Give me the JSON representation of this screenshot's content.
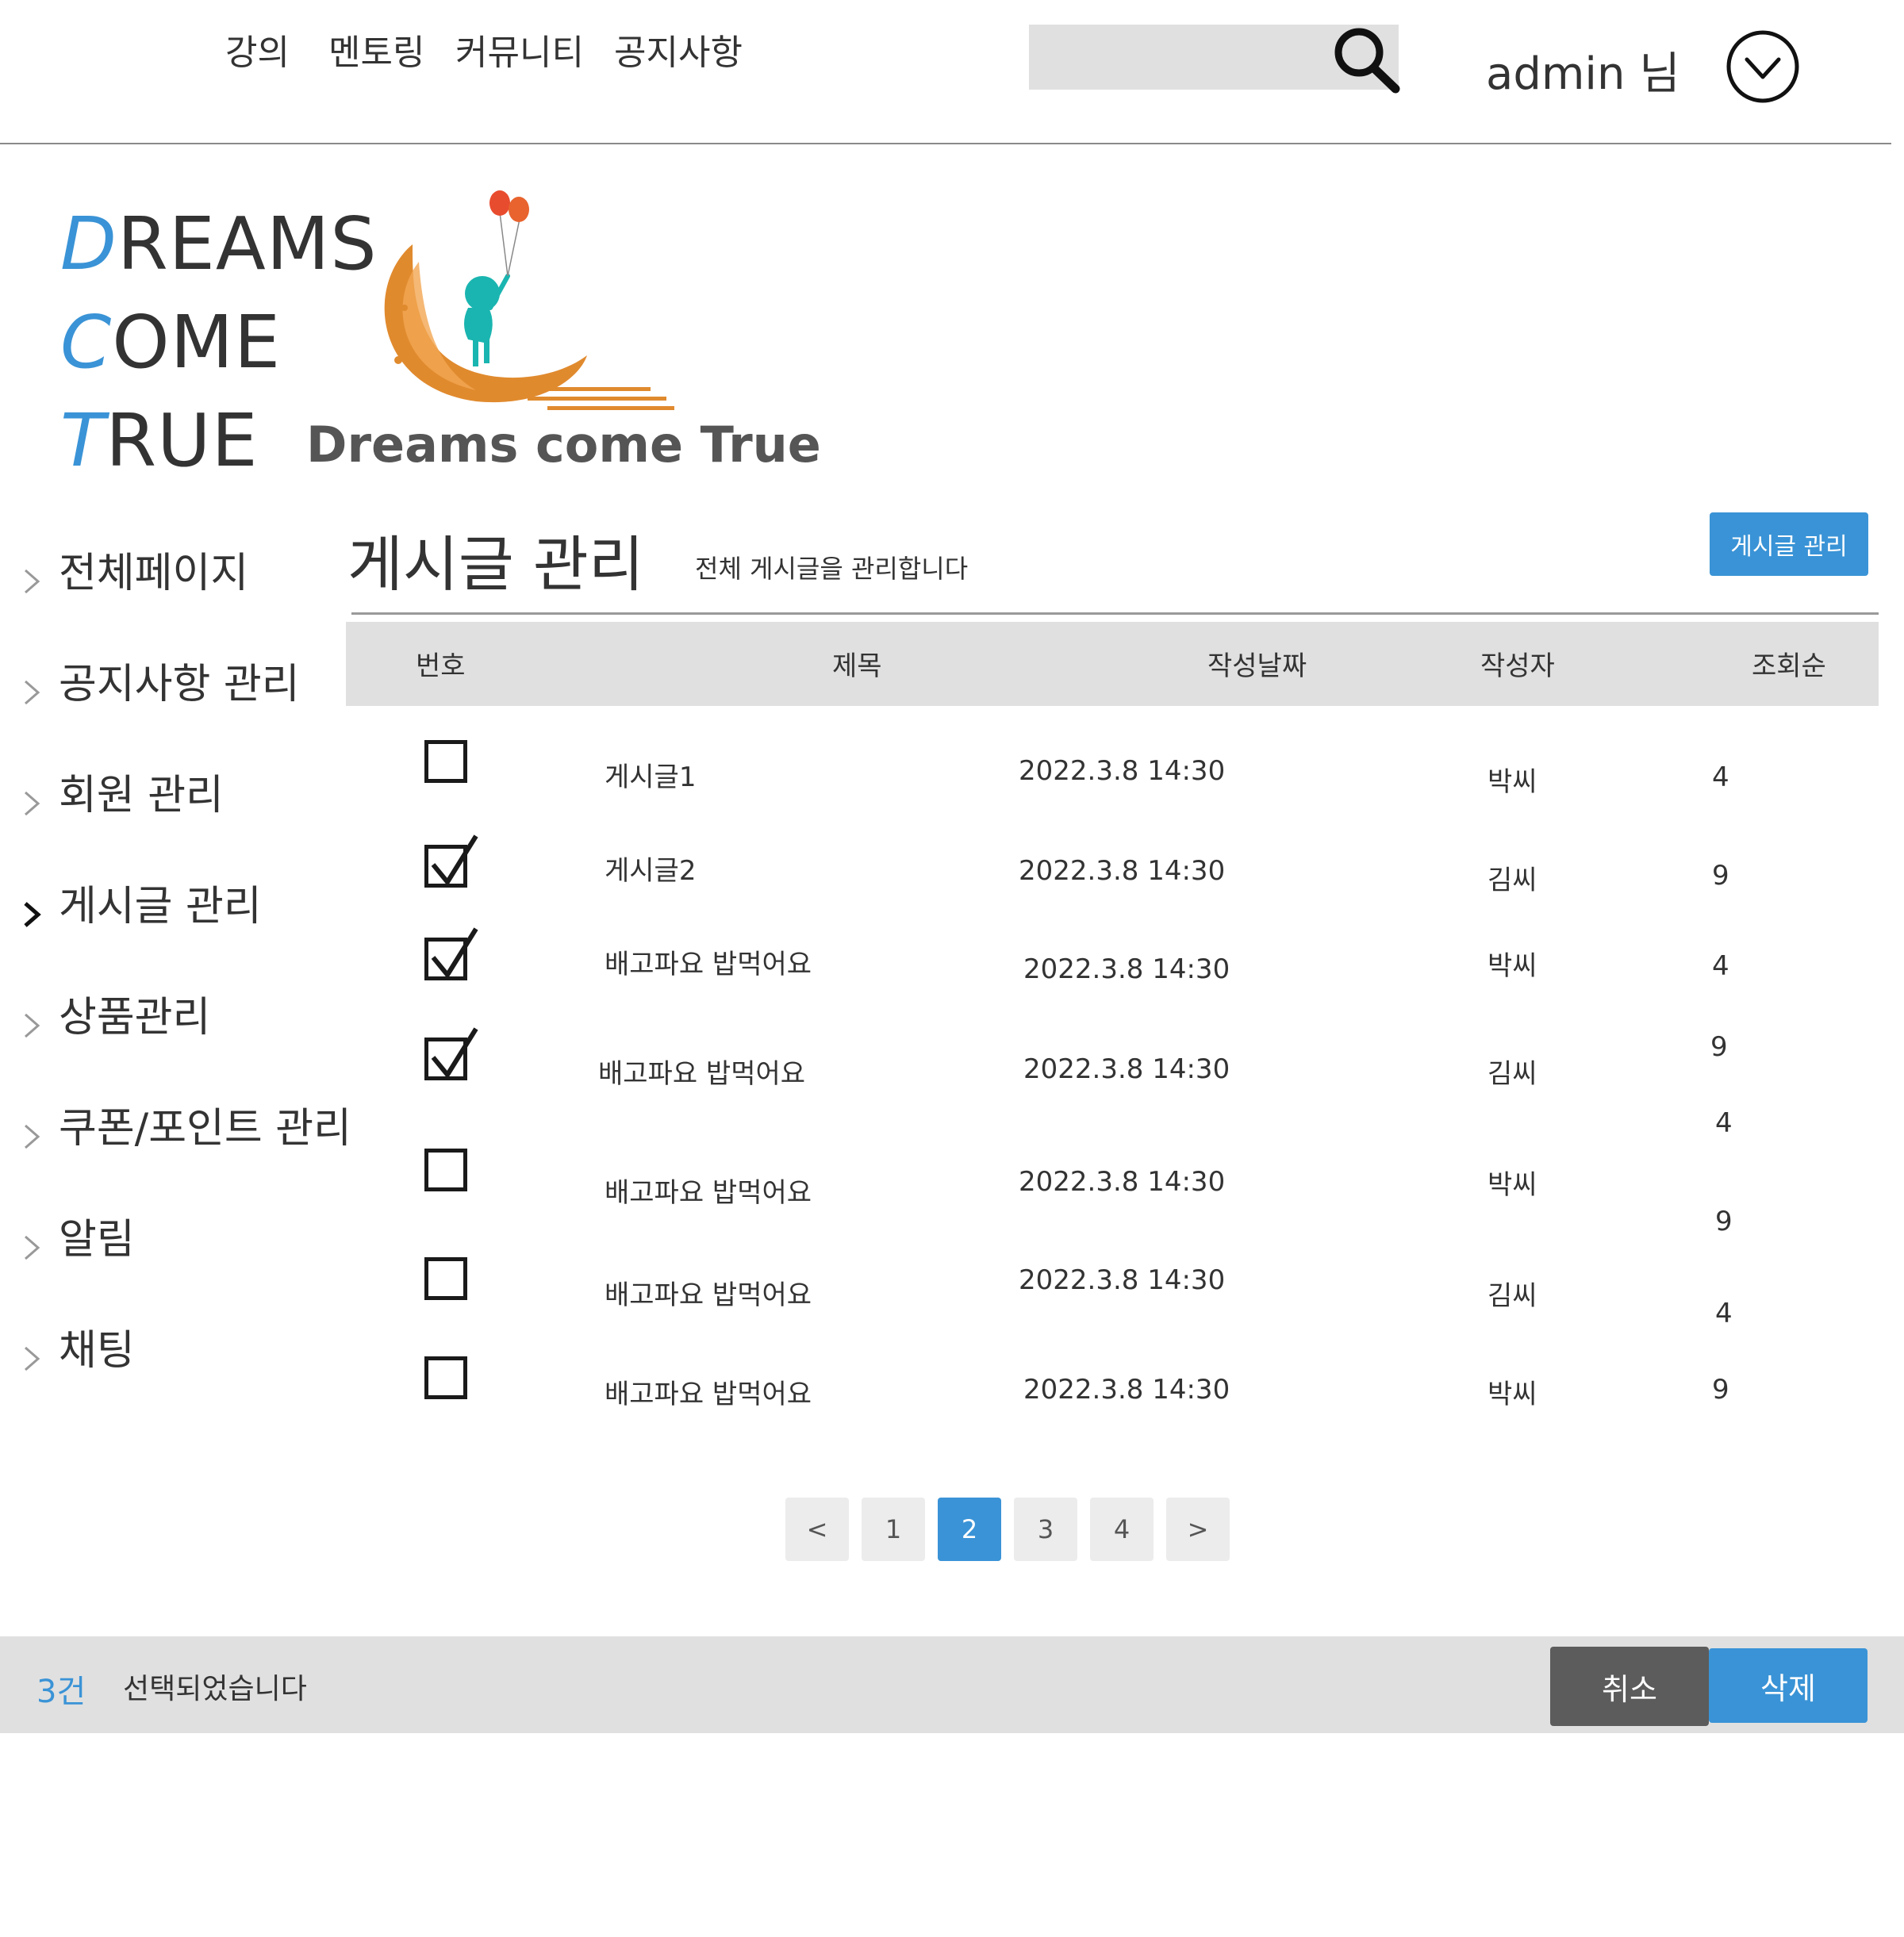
{
  "nav": {
    "items": [
      "강의",
      "멘토링",
      "커뮤니티",
      "공지사항"
    ]
  },
  "search": {
    "placeholder": ""
  },
  "user": {
    "name": "admin 님"
  },
  "logo": {
    "lines": [
      {
        "cap": "D",
        "rest": "REAMS"
      },
      {
        "cap": "C",
        "rest": "OME"
      },
      {
        "cap": "T",
        "rest": "RUE"
      }
    ],
    "tagline": "Dreams come True"
  },
  "sidebar": {
    "items": [
      {
        "label": "전체페이지",
        "active": false
      },
      {
        "label": "공지사항 관리",
        "active": false
      },
      {
        "label": "회원 관리",
        "active": false
      },
      {
        "label": "게시글 관리",
        "active": true
      },
      {
        "label": "상품관리",
        "active": false
      },
      {
        "label": "쿠폰/포인트 관리",
        "active": false
      },
      {
        "label": "알림",
        "active": false
      },
      {
        "label": "채팅",
        "active": false
      }
    ]
  },
  "page": {
    "title": "게시글 관리",
    "subtitle": "전체 게시글을 관리합니다",
    "manage_button": "게시글 관리"
  },
  "table": {
    "headers": [
      "번호",
      "제목",
      "작성날짜",
      "작성자",
      "조회순"
    ],
    "rows": [
      {
        "checked": false,
        "title": "게시글1",
        "date": "2022.3.8 14:30",
        "author": "박씨",
        "views": "4"
      },
      {
        "checked": true,
        "title": "게시글2",
        "date": "2022.3.8 14:30",
        "author": "김씨",
        "views": "9"
      },
      {
        "checked": true,
        "title": "배고파요 밥먹어요",
        "date": "2022.3.8 14:30",
        "author": "박씨",
        "views": "4"
      },
      {
        "checked": true,
        "title": "배고파요 밥먹어요",
        "date": "2022.3.8 14:30",
        "author": "김씨",
        "views": "9"
      },
      {
        "checked": false,
        "title": "배고파요 밥먹어요",
        "date": "2022.3.8 14:30",
        "author": "박씨",
        "views": "4"
      },
      {
        "checked": false,
        "title": "배고파요 밥먹어요",
        "date": "2022.3.8 14:30",
        "author": "김씨",
        "views": "9"
      },
      {
        "checked": false,
        "title": "배고파요 밥먹어요",
        "date": "2022.3.8 14:30",
        "author": "박씨",
        "views": "4"
      }
    ],
    "extra_views": "9"
  },
  "pagination": {
    "prev": "<",
    "pages": [
      "1",
      "2",
      "3",
      "4"
    ],
    "current": "2",
    "next": ">"
  },
  "selection": {
    "count": "3건",
    "text": "선택되었습니다"
  },
  "actions": {
    "cancel": "취소",
    "delete": "삭제"
  },
  "colors": {
    "accent": "#3a93d6",
    "cancel": "#5c5c5c",
    "bar": "#e0e0e0"
  }
}
